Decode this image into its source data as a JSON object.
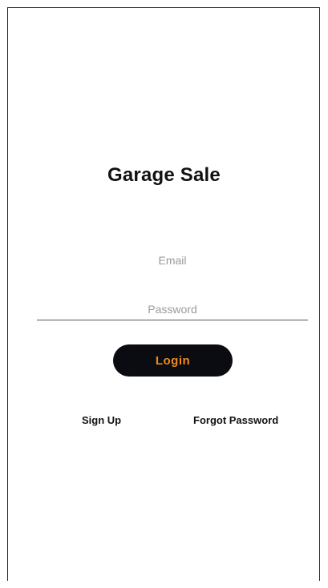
{
  "app": {
    "title": "Garage Sale"
  },
  "form": {
    "email_placeholder": "Email",
    "password_placeholder": "Password",
    "login_label": "Login"
  },
  "links": {
    "sign_up": "Sign Up",
    "forgot_password": "Forgot Password"
  },
  "colors": {
    "button_background": "#0b0b12",
    "button_text": "#f08a1c",
    "page_background": "#ffffff"
  }
}
